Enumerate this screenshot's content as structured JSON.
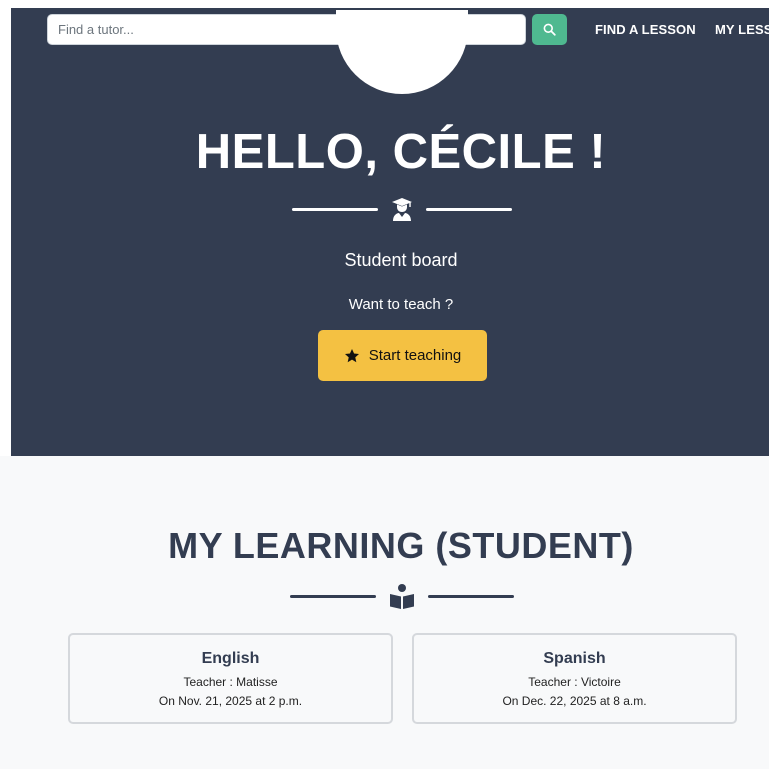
{
  "nav": {
    "search_placeholder": "Find a tutor...",
    "links": [
      "FIND A LESSON",
      "MY LESSONS"
    ]
  },
  "hero": {
    "greeting": "HELLO, CÉCILE !",
    "role": "Student board",
    "teach_prompt": "Want to teach ?",
    "teach_button": "Start teaching",
    "divider_icon": "graduate-icon"
  },
  "learning": {
    "title": "MY LEARNING (STUDENT)",
    "divider_icon": "book-reader-icon",
    "lessons": [
      {
        "language": "English",
        "teacher": "Teacher : Matisse",
        "date": "On Nov. 21, 2025 at 2 p.m."
      },
      {
        "language": "Spanish",
        "teacher": "Teacher : Victoire",
        "date": "On Dec. 22, 2025 at 8 a.m."
      }
    ]
  },
  "colors": {
    "hero_bg": "#333d51",
    "accent_green": "#4fb990",
    "accent_yellow": "#f4c142",
    "page_bg": "#f8f9fa"
  }
}
